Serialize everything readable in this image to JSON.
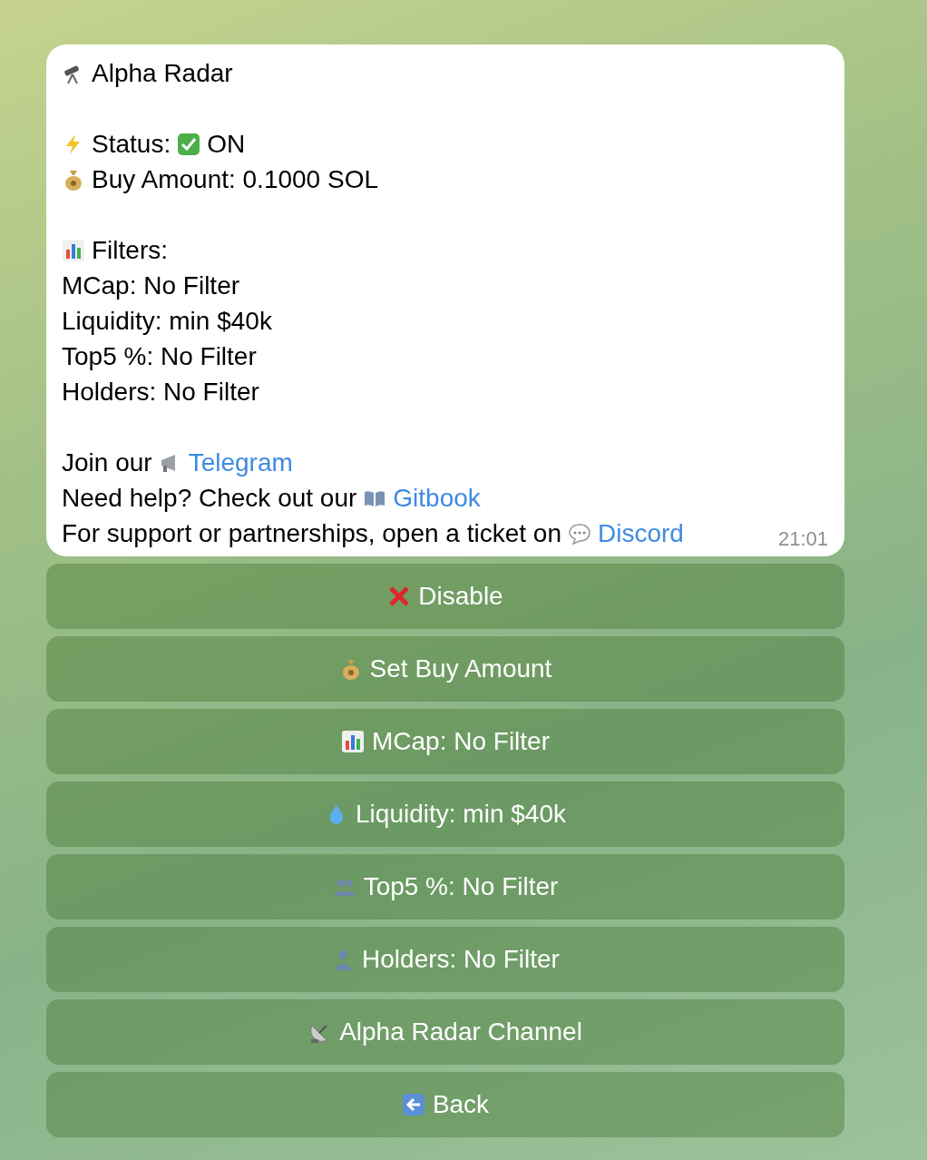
{
  "message": {
    "paragraphs": [
      [
        [
          {
            "kind": "telescope"
          },
          {
            "kind": "text",
            "text": "Alpha Radar"
          }
        ]
      ],
      [
        [
          {
            "kind": "bolt"
          },
          {
            "kind": "text",
            "text": "Status:"
          },
          {
            "kind": "check"
          },
          {
            "kind": "text",
            "text": "ON"
          }
        ],
        [
          {
            "kind": "moneybag"
          },
          {
            "kind": "text",
            "text": "Buy Amount: 0.1000 SOL"
          }
        ]
      ],
      [
        [
          {
            "kind": "chart"
          },
          {
            "kind": "text",
            "text": "Filters:"
          }
        ],
        [
          {
            "kind": "text",
            "text": "MCap: No Filter"
          }
        ],
        [
          {
            "kind": "text",
            "text": "Liquidity: min $40k"
          }
        ],
        [
          {
            "kind": "text",
            "text": "Top5 %: No Filter"
          }
        ],
        [
          {
            "kind": "text",
            "text": "Holders: No Filter"
          }
        ]
      ],
      [
        [
          {
            "kind": "text",
            "text": "Join our"
          },
          {
            "kind": "megaphone"
          },
          {
            "kind": "link",
            "text": "Telegram"
          }
        ],
        [
          {
            "kind": "text",
            "text": "Need help? Check out our"
          },
          {
            "kind": "book"
          },
          {
            "kind": "link",
            "text": "Gitbook"
          }
        ],
        [
          {
            "kind": "text",
            "text": "For support or partnerships, open a ticket on"
          },
          {
            "kind": "speech"
          },
          {
            "kind": "link",
            "text": "Discord"
          }
        ]
      ]
    ],
    "time": "21:01"
  },
  "buttons": [
    {
      "kind": "cross",
      "label": "Disable"
    },
    {
      "kind": "moneybag",
      "label": "Set Buy Amount"
    },
    {
      "kind": "chart",
      "label": "MCap: No Filter"
    },
    {
      "kind": "drop",
      "label": "Liquidity: min $40k"
    },
    {
      "kind": "people",
      "label": "Top5 %: No Filter"
    },
    {
      "kind": "person",
      "label": "Holders: No Filter"
    },
    {
      "kind": "satellite",
      "label": "Alpha Radar Channel"
    },
    {
      "kind": "back",
      "label": "Back"
    }
  ]
}
